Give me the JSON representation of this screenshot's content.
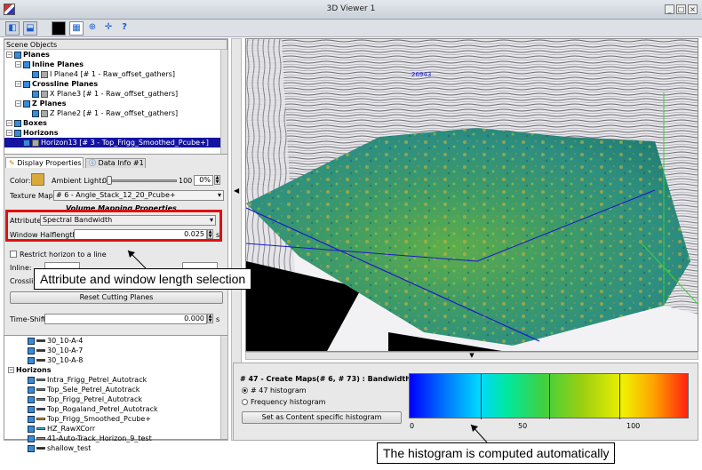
{
  "window": {
    "title": "3D Viewer 1",
    "controls": [
      "_",
      "□",
      "×"
    ]
  },
  "scene": {
    "header": "Scene Objects",
    "items": [
      {
        "label": "Planes",
        "bold": true,
        "level": 0
      },
      {
        "label": "Inline Planes",
        "bold": true,
        "level": 1
      },
      {
        "label": "I Plane4 [# 1 - Raw_offset_gathers]",
        "level": 2
      },
      {
        "label": "Crossline Planes",
        "bold": true,
        "level": 1
      },
      {
        "label": "X Plane3 [# 1 - Raw_offset_gathers]",
        "level": 2
      },
      {
        "label": "Z Planes",
        "bold": true,
        "level": 1
      },
      {
        "label": "Z Plane2 [# 1 - Raw_offset_gathers]",
        "level": 2
      },
      {
        "label": "Boxes",
        "bold": true,
        "level": 0
      },
      {
        "label": "Horizons",
        "bold": true,
        "level": 0
      },
      {
        "label": "Horizon13 [# 3 - Top_Frigg_Smoothed_Pcube+]",
        "level": 1,
        "selected": true
      }
    ]
  },
  "tabs": {
    "display": "Display Properties",
    "data": "Data Info #1"
  },
  "props": {
    "color_label": "Color:",
    "color": "#d9a93a",
    "ambient_label": "Ambient Light:",
    "ambient_min": "0",
    "ambient_max": "100",
    "opacity": "0%",
    "texture_label": "Texture Map:",
    "texture_value": "# 6 - Angle_Stack_12_20_Pcube+",
    "section": "Volume Mapping Properties",
    "attribute_label": "Attribute",
    "attribute_value": "Spectral Bandwidth",
    "halflength_label": "Window Halflength",
    "halflength_value": "0.025",
    "halflength_unit": "s",
    "restrict_label": "Restrict horizon to a line",
    "inline_label": "Inline:",
    "crossline_label": "Crossli",
    "reset_label": "Reset Cutting Planes",
    "timeshift_label": "Time-Shift",
    "timeshift_value": "0.000",
    "timeshift_unit": "s"
  },
  "wells": {
    "items": [
      {
        "label": "30_10-A-4",
        "color": "#333333"
      },
      {
        "label": "30_10-A-7",
        "color": "#333333"
      },
      {
        "label": "30_10-A-8",
        "color": "#333333"
      }
    ],
    "horizons_header": "Horizons",
    "horizons": [
      {
        "label": "Intra_Frigg_Petrel_Autotrack",
        "color": "#2fa32f"
      },
      {
        "label": "Top_Sele_Petrel_Autotrack",
        "color": "#d04040"
      },
      {
        "label": "Top_Frigg_Petrel_Autotrack",
        "color": "#c040c0"
      },
      {
        "label": "Top_Rogaland_Petrel_Autotrack",
        "color": "#3030d0"
      },
      {
        "label": "Top_Frigg_Smoothed_Pcube+",
        "color": "#e0a020"
      },
      {
        "label": "HZ_RawXCorr",
        "color": "#40b0d0"
      },
      {
        "label": "41-Auto-Track_Horizon_9_test",
        "color": "#888888"
      },
      {
        "label": "shallow_test",
        "color": "#222222"
      }
    ]
  },
  "viewer": {
    "label": "26943"
  },
  "histogram": {
    "title": "# 47 - Create Maps(# 6, # 73) : Bandwidth",
    "radio1": "# 47 histogram",
    "radio2": "Frequency histogram",
    "button": "Set as Content specific histogram",
    "ticks": [
      "0",
      "50",
      "100"
    ]
  },
  "callouts": {
    "attribute": "Attribute and window length selection",
    "histogram": "The histogram is computed automatically"
  }
}
